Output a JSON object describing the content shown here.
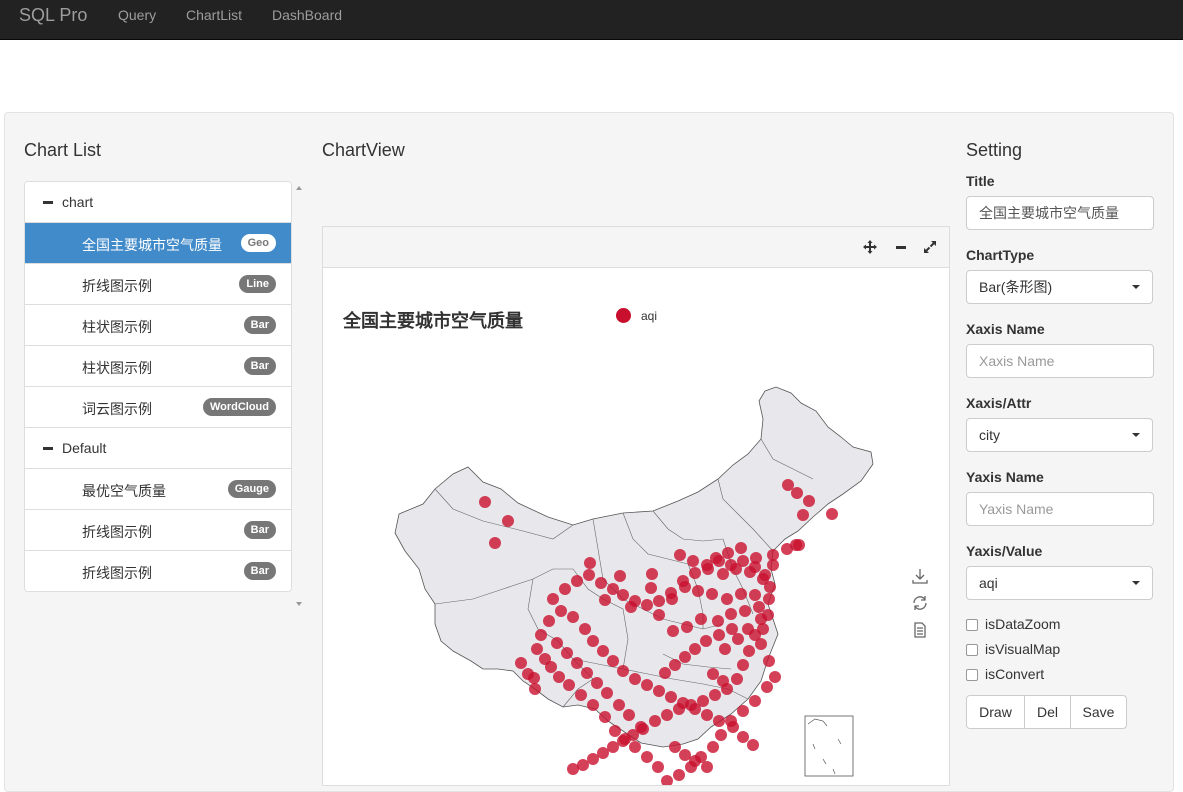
{
  "navbar": {
    "brand": "SQL Pro",
    "links": [
      "Query",
      "ChartList",
      "DashBoard"
    ]
  },
  "chart_list": {
    "title": "Chart List",
    "rows": [
      {
        "type": "group",
        "label": "chart"
      },
      {
        "type": "item",
        "label": "全国主要城市空气质量",
        "badge": "Geo",
        "active": true
      },
      {
        "type": "item",
        "label": "折线图示例",
        "badge": "Line"
      },
      {
        "type": "item",
        "label": "柱状图示例",
        "badge": "Bar"
      },
      {
        "type": "item",
        "label": "柱状图示例",
        "badge": "Bar"
      },
      {
        "type": "item",
        "label": "词云图示例",
        "badge": "WordCloud"
      },
      {
        "type": "group",
        "label": "Default"
      },
      {
        "type": "item",
        "label": "最优空气质量",
        "badge": "Gauge"
      },
      {
        "type": "item",
        "label": "折线图示例",
        "badge": "Bar"
      },
      {
        "type": "item",
        "label": "折线图示例",
        "badge": "Bar"
      }
    ]
  },
  "chart_view": {
    "title": "ChartView",
    "header_icons": [
      "move-icon",
      "minimize-icon",
      "expand-icon"
    ],
    "chart": {
      "title": "全国主要城市空气质量",
      "legend": "aqi",
      "series_color": "#c8102e",
      "map_fill": "#e8e8ec",
      "toolbox": [
        "download-icon",
        "refresh-icon",
        "data-view-icon"
      ]
    }
  },
  "setting": {
    "title": "Setting",
    "title_label": "Title",
    "title_value": "全国主要城市空气质量",
    "chart_type_label": "ChartType",
    "chart_type_value": "Bar(条形图)",
    "xaxis_name_label": "Xaxis Name",
    "xaxis_name_placeholder": "Xaxis Name",
    "xaxis_attr_label": "Xaxis/Attr",
    "xaxis_attr_value": "city",
    "yaxis_name_label": "Yaxis Name",
    "yaxis_name_placeholder": "Yaxis Name",
    "yaxis_value_label": "Yaxis/Value",
    "yaxis_value_value": "aqi",
    "checkboxes": [
      "isDataZoom",
      "isVisualMap",
      "isConvert"
    ],
    "buttons": [
      "Draw",
      "Del",
      "Save"
    ]
  }
}
